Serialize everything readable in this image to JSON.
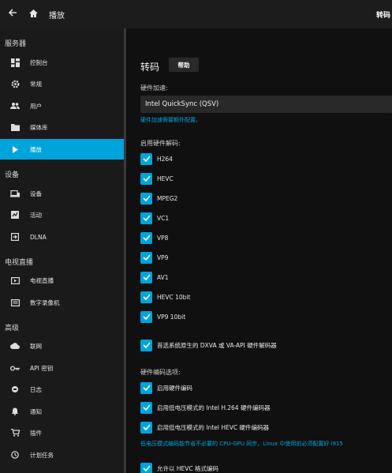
{
  "topbar": {
    "title": "播放",
    "right_title": "转码"
  },
  "sidebar": {
    "sections": [
      {
        "header": "服务器"
      },
      {
        "header": "设备"
      },
      {
        "header": "电视直播"
      },
      {
        "header": "高级"
      }
    ],
    "items": [
      {
        "label": "控制台",
        "icon": "dashboard-icon"
      },
      {
        "label": "常规",
        "icon": "settings-icon"
      },
      {
        "label": "用户",
        "icon": "users-icon"
      },
      {
        "label": "媒体库",
        "icon": "folder-icon"
      },
      {
        "label": "播放",
        "icon": "play-icon",
        "active": true
      },
      {
        "label": "设备",
        "icon": "devices-icon"
      },
      {
        "label": "活动",
        "icon": "activity-icon"
      },
      {
        "label": "DLNA",
        "icon": "dlna-icon"
      },
      {
        "label": "电视直播",
        "icon": "live-tv-icon"
      },
      {
        "label": "数字录像机",
        "icon": "dvr-icon"
      },
      {
        "label": "联网",
        "icon": "cloud-icon"
      },
      {
        "label": "API 密钥",
        "icon": "key-icon"
      },
      {
        "label": "日志",
        "icon": "log-icon"
      },
      {
        "label": "通知",
        "icon": "bell-icon"
      },
      {
        "label": "插件",
        "icon": "cart-icon"
      },
      {
        "label": "计划任务",
        "icon": "clock-icon"
      }
    ]
  },
  "main": {
    "title": "转码",
    "help_label": "帮助",
    "hw_accel_label": "硬件加速:",
    "hw_accel_value": "Intel QuickSync (QSV)",
    "hw_accel_link": "硬件加速需要额外配置。",
    "hw_decode_label": "启用硬件解码:",
    "decoders": [
      "H264",
      "HEVC",
      "MPEG2",
      "VC1",
      "VP8",
      "VP9",
      "AV1",
      "HEVC 10bit",
      "VP9 10bit"
    ],
    "prefer_native": "首选系统原生的 DXVA 或 VA-API 硬件解码器",
    "hw_encode_label": "硬件编码选项:",
    "encode_options": [
      "启用硬件编码",
      "启用低电压模式的 Intel H.264 硬件编码器",
      "启用低电压模式的 Intel HEVC 硬件编码器"
    ],
    "low_power_note": "低电压模式编码能节省不必要的 CPU-GPU 同步。Linux 中使用前必须配置好 i915",
    "allow_hevc": "允许以 HEVC 格式编码"
  },
  "colors": {
    "accent": "#00a4dc",
    "background": "#101010",
    "sidebar": "#1a1a1a"
  }
}
